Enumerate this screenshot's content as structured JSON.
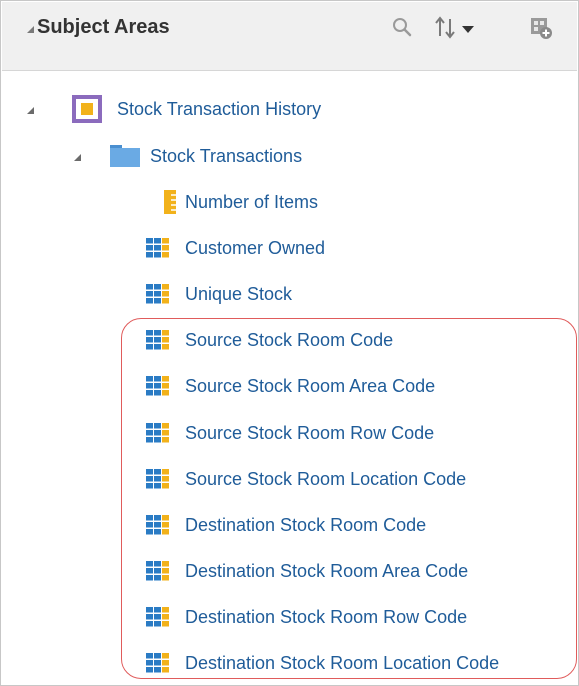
{
  "header": {
    "title": "Subject Areas",
    "icons": [
      "search-icon",
      "sort-icon",
      "add-subject-area-icon"
    ]
  },
  "tree": {
    "root": {
      "label": "Stock Transaction History",
      "icon": "subject-area-icon"
    },
    "folder": {
      "label": "Stock Transactions",
      "icon": "folder-icon"
    },
    "items": [
      {
        "label": "Number of Items",
        "icon": "measure-icon"
      },
      {
        "label": "Customer Owned",
        "icon": "attribute-icon"
      },
      {
        "label": "Unique Stock",
        "icon": "attribute-icon"
      },
      {
        "label": "Source Stock Room Code",
        "icon": "attribute-icon"
      },
      {
        "label": "Source Stock Room Area Code",
        "icon": "attribute-icon"
      },
      {
        "label": "Source Stock Room Row Code",
        "icon": "attribute-icon"
      },
      {
        "label": "Source Stock Room Location Code",
        "icon": "attribute-icon"
      },
      {
        "label": "Destination Stock Room Code",
        "icon": "attribute-icon"
      },
      {
        "label": "Destination Stock Room Area Code",
        "icon": "attribute-icon"
      },
      {
        "label": "Destination Stock Room Row Code",
        "icon": "attribute-icon"
      },
      {
        "label": "Destination Stock Room Location Code",
        "icon": "attribute-icon"
      }
    ]
  },
  "colors": {
    "link": "#1f5c99",
    "highlight": "#e05b5b",
    "header_bg": "#f0f0f0"
  }
}
